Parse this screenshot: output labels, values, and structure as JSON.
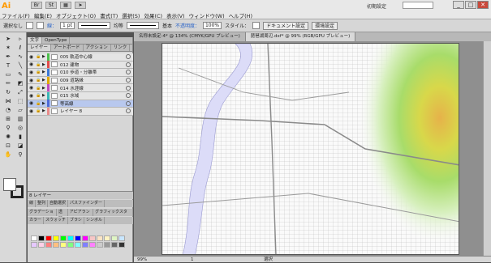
{
  "app": {
    "logo": "Ai",
    "workspace": "初期設定",
    "window_controls": [
      "_",
      "□",
      "✕"
    ]
  },
  "menu": [
    "ファイル(F)",
    "編集(E)",
    "オブジェクト(O)",
    "書式(T)",
    "選択(S)",
    "効果(C)",
    "表示(V)",
    "ウィンドウ(W)",
    "ヘルプ(H)"
  ],
  "control": {
    "selection": "選択なし",
    "stroke_label": "線：",
    "stroke_value": "1 pt",
    "profile1": "均等",
    "profile2": "基本",
    "opacity_label": "不透明度：",
    "opacity_value": "100%",
    "style_label": "スタイル：",
    "doc_setup": "ドキュメント設定",
    "prefs": "環境設定"
  },
  "layers_panel": {
    "tabs": [
      "文字",
      "OpenType",
      "レイヤー",
      "アートボード",
      "アクション",
      "リンク"
    ],
    "layers": [
      {
        "name": "005 軌道中心線",
        "color": "#4cc04c",
        "selected": false
      },
      {
        "name": "012 建物",
        "color": "#e14b4b",
        "selected": false
      },
      {
        "name": "010 歩道・分離帯",
        "color": "#3a78d8",
        "selected": false
      },
      {
        "name": "009 道路縁",
        "color": "#e0a800",
        "selected": false
      },
      {
        "name": "014 水涯線",
        "color": "#c04cc0",
        "selected": false
      },
      {
        "name": "015 水域",
        "color": "#39b7b7",
        "selected": false
      },
      {
        "name": "等高線",
        "color": "#4c68d8",
        "selected": true
      },
      {
        "name": "レイヤー 8",
        "color": "#e88a8a",
        "selected": false
      }
    ],
    "footer": "8 レイヤー"
  },
  "lower_tabs": [
    "線",
    "整列",
    "自動選択",
    "パスファインダー"
  ],
  "lower_tabs2": [
    "グラデーション",
    "透明",
    "アピアランス",
    "グラフィックスタイル"
  ],
  "lower_tabs3": [
    "カラー",
    "スウォッチ",
    "ブラシ",
    "シンボル"
  ],
  "swatch_colors": [
    "#ffffff",
    "#000000",
    "#ff0000",
    "#ffff00",
    "#00ff00",
    "#00ffff",
    "#0000ff",
    "#ff00ff",
    "#f7c6c6",
    "#fce4c4",
    "#fff4c4",
    "#dff4c4",
    "#c8e6ff",
    "#e6c8ff",
    "#ffd0e8",
    "#ff8080",
    "#ffc080",
    "#ffff80",
    "#80ff80",
    "#80ffff",
    "#8080ff",
    "#ff80ff",
    "#cccccc",
    "#999999",
    "#666666",
    "#333333"
  ],
  "document_tabs": [
    "名称未設定-4* @ 134% (CMYK/GPU プレビュー)",
    "琵琶湖周辺.dxf* @ 99% (RGB/GPU プレビュー)"
  ],
  "status": {
    "zoom": "99%",
    "page": "1",
    "mode": "選択"
  }
}
